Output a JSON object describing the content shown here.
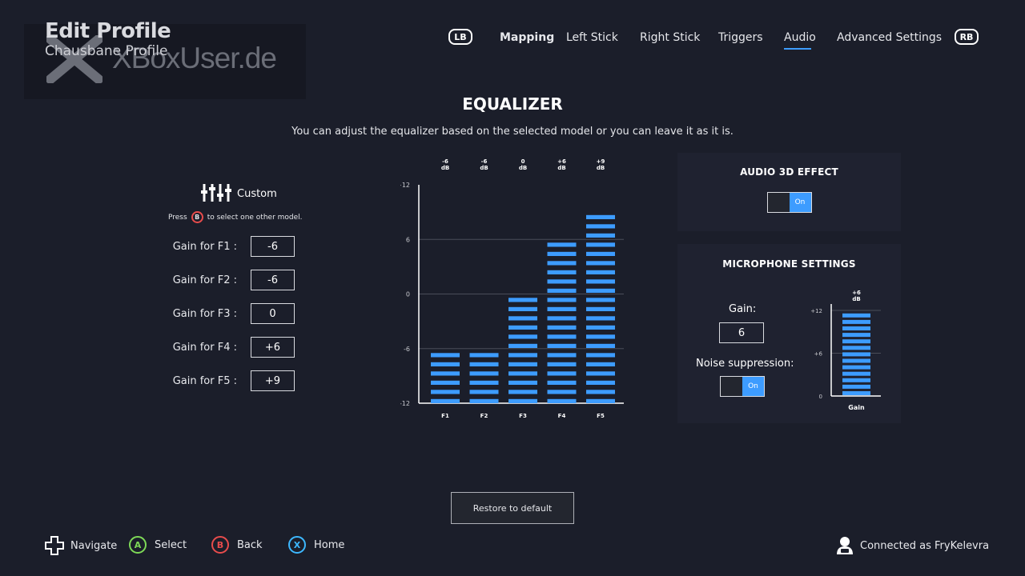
{
  "header": {
    "title": "Edit Profile",
    "subtitle": "Chausbane Profile",
    "watermark": "XBoxUser.de"
  },
  "nav": {
    "lb_label": "LB",
    "rb_label": "RB",
    "tabs": [
      {
        "label": "Mapping",
        "active": false
      },
      {
        "label": "Left Stick",
        "active": false
      },
      {
        "label": "Right Stick",
        "active": false
      },
      {
        "label": "Triggers",
        "active": false
      },
      {
        "label": "Audio",
        "active": true
      },
      {
        "label": "Advanced Settings",
        "active": false
      }
    ]
  },
  "equalizer": {
    "title": "EQUALIZER",
    "description": "You can adjust the equalizer based on the selected model or you can leave it as it is.",
    "preset_label": "Custom",
    "press_prefix": "Press",
    "press_button": "B",
    "press_suffix": "to select one other model.",
    "gains": [
      {
        "label": "Gain for F1 :",
        "value": "-6"
      },
      {
        "label": "Gain for F2 :",
        "value": "-6"
      },
      {
        "label": "Gain for F3 :",
        "value": "0"
      },
      {
        "label": "Gain for F4 :",
        "value": "+6"
      },
      {
        "label": "Gain for F5 :",
        "value": "+9"
      }
    ]
  },
  "chart_data": {
    "type": "bar",
    "categories": [
      "F1",
      "F2",
      "F3",
      "F4",
      "F5"
    ],
    "values": [
      -6,
      -6,
      0,
      6,
      9
    ],
    "top_labels": [
      "-6",
      "-6",
      "0",
      "+6",
      "+9"
    ],
    "top_unit": "dB",
    "yticks": [
      "+12",
      "6",
      "0",
      "-6",
      "-12"
    ],
    "ylim": [
      -12,
      12
    ],
    "grid": true
  },
  "audio3d": {
    "title": "AUDIO 3D EFFECT",
    "toggle_label": "On"
  },
  "microphone": {
    "title": "MICROPHONE SETTINGS",
    "gain_label": "Gain:",
    "gain_value": "6",
    "noise_label": "Noise suppression:",
    "noise_toggle_label": "On",
    "chart_data": {
      "type": "bar",
      "categories": [
        "Gain"
      ],
      "values": [
        12
      ],
      "top_label": "+6",
      "top_unit": "dB",
      "yticks": [
        "+12",
        "+6",
        "0"
      ],
      "ylim": [
        0,
        12
      ]
    }
  },
  "restore_label": "Restore to default",
  "footer": {
    "navigate": "Navigate",
    "select_btn": "A",
    "select": "Select",
    "back_btn": "B",
    "back": "Back",
    "home_btn": "X",
    "home": "Home",
    "connected": "Connected as FryKelevra"
  },
  "colors": {
    "accent": "#3d9cff",
    "background": "#1b1e2a",
    "a_button": "#7ed957",
    "b_button": "#e84c4c",
    "x_button": "#3db8ff"
  }
}
